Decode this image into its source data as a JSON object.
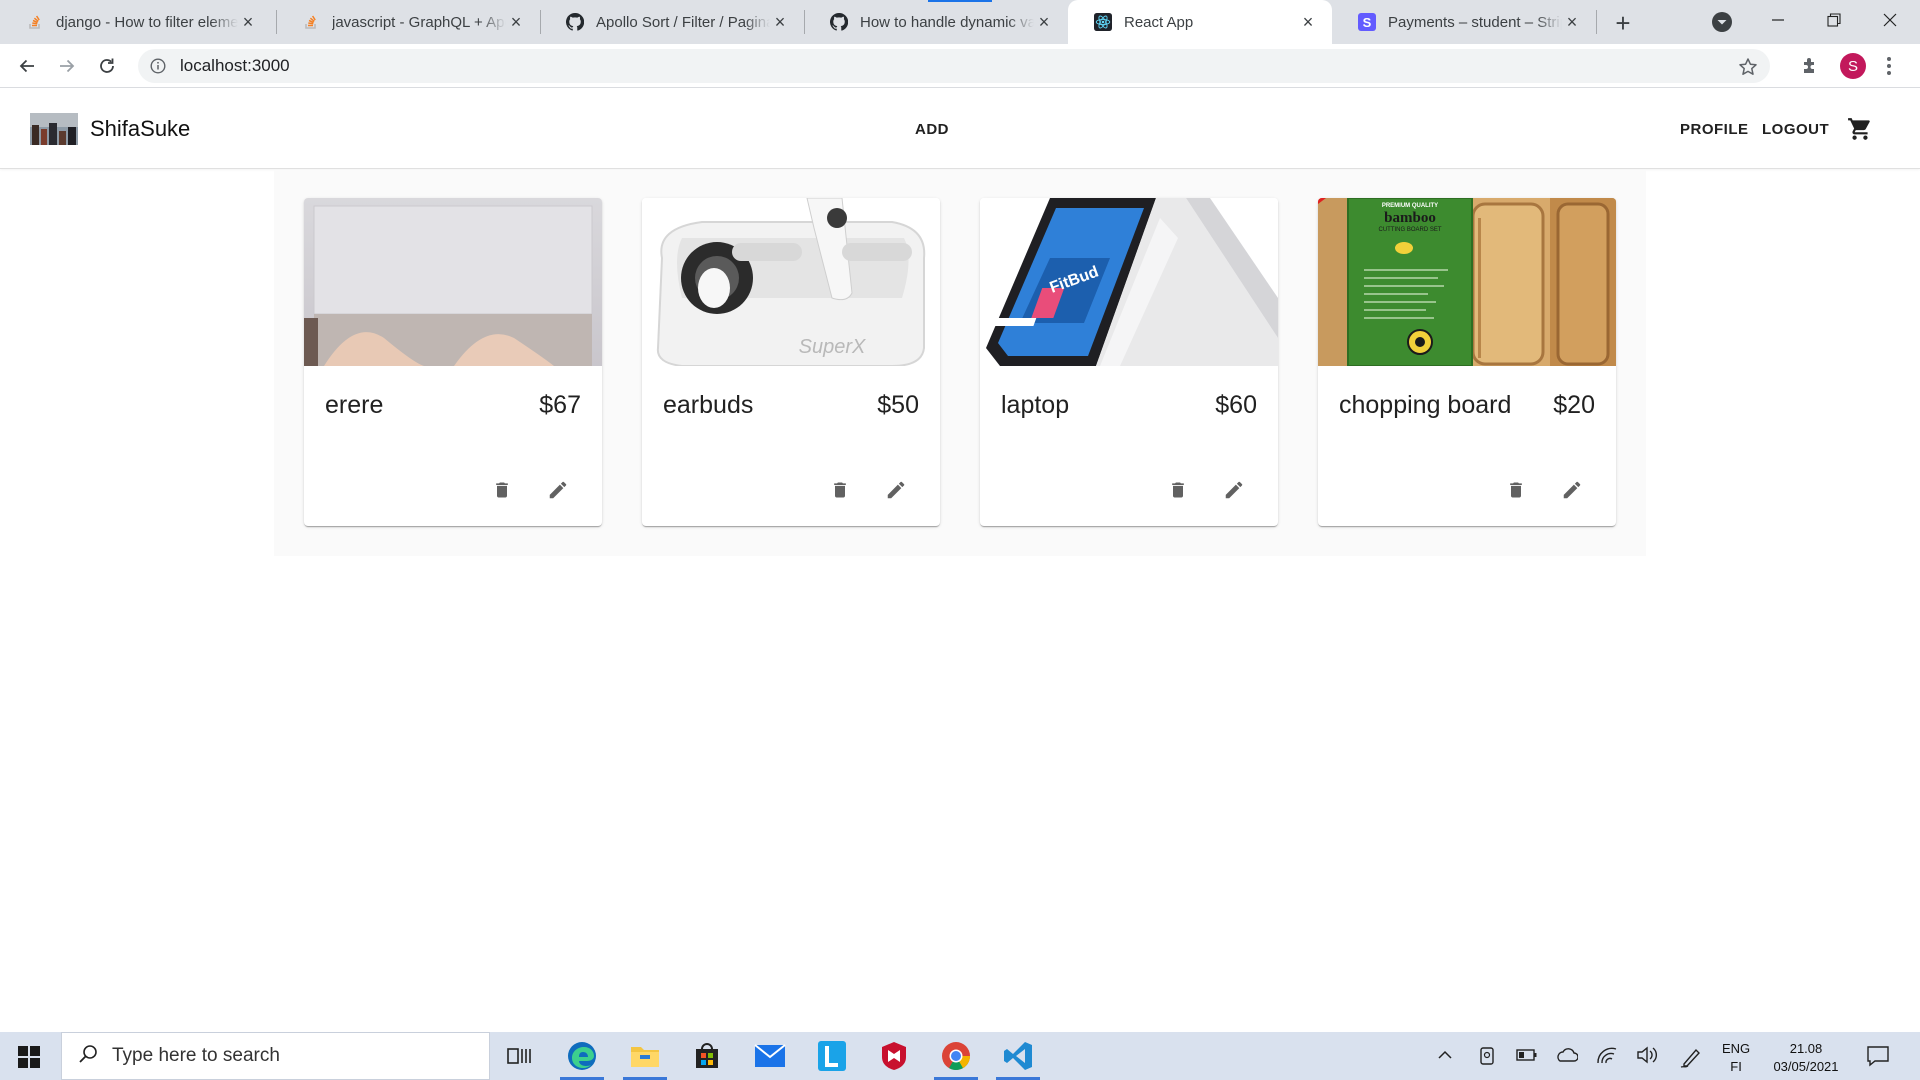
{
  "browser": {
    "tabs": [
      {
        "title": "django - How to filter eleme",
        "icon": "stackoverflow-icon"
      },
      {
        "title": "javascript - GraphQL + Apol",
        "icon": "stackoverflow-icon"
      },
      {
        "title": "Apollo Sort / Filter / Paginat",
        "icon": "github-icon"
      },
      {
        "title": "How to handle dynamic var",
        "icon": "github-icon"
      },
      {
        "title": "React App",
        "icon": "react-icon",
        "active": true
      },
      {
        "title": "Payments – student – Stripe",
        "icon": "stripe-icon"
      }
    ],
    "url": "localhost:3000",
    "profile_initial": "S"
  },
  "app": {
    "brand": "ShifaSuke",
    "nav": {
      "add": "ADD",
      "profile": "PROFILE",
      "logout": "LOGOUT"
    },
    "icons": {
      "cart": "cart-icon",
      "delete": "trash-icon",
      "edit": "pencil-icon"
    }
  },
  "products": [
    {
      "name": "erere",
      "price": "$67"
    },
    {
      "name": "earbuds",
      "price": "$50",
      "image_text": "SuperX"
    },
    {
      "name": "laptop",
      "price": "$60",
      "image_text": "FitBud"
    },
    {
      "name": "chopping board",
      "price": "$20",
      "image_text": {
        "line1": "PREMIUM QUALITY",
        "line2": "bamboo",
        "line3": "CUTTING BOARD SET"
      }
    }
  ],
  "taskbar": {
    "search_placeholder": "Type here to search",
    "lang": {
      "line1": "ENG",
      "line2": "FI"
    },
    "clock": {
      "time": "21.08",
      "date": "03/05/2021"
    }
  },
  "colors": {
    "accent": "#1a73e8",
    "tabstrip": "#dee1e6",
    "avatar": "#c2185b",
    "icon_gray": "#616161"
  }
}
